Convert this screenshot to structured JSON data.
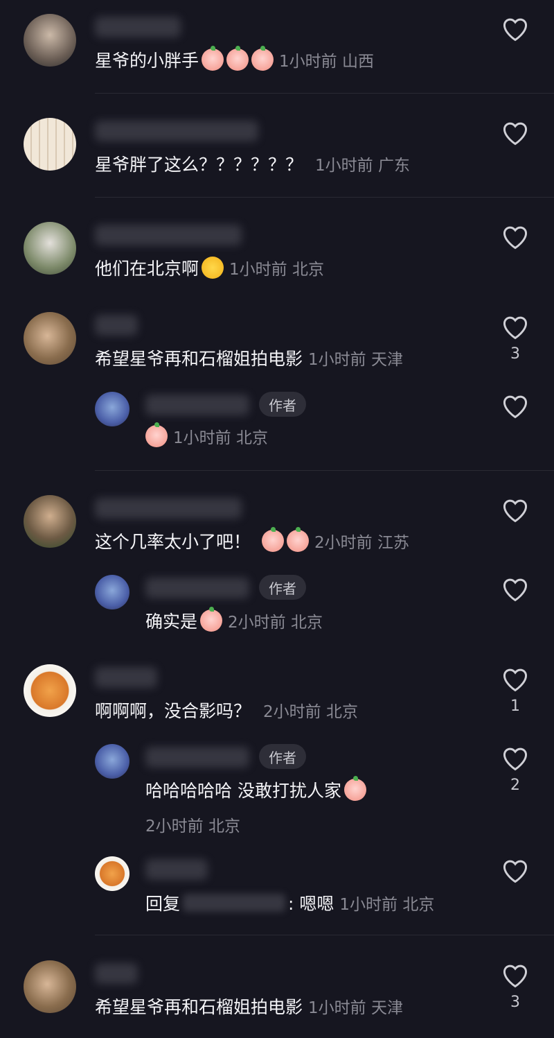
{
  "comments": [
    {
      "text": "星爷的小胖手",
      "emojis": [
        "pig-face",
        "pig-face",
        "pig-face"
      ],
      "time": "1小时前",
      "location": "山西",
      "likes": ""
    },
    {
      "text": "星爷胖了这么？？？？？？",
      "time": "1小时前",
      "location": "广东",
      "likes": ""
    },
    {
      "text": "他们在北京啊",
      "emojis": [
        "star-struck"
      ],
      "time": "1小时前",
      "location": "北京",
      "likes": ""
    },
    {
      "text": "希望星爷再和石榴姐拍电影",
      "time": "1小时前",
      "location": "天津",
      "likes": "3"
    },
    {
      "reply": true,
      "badge": "作者",
      "text": "",
      "emojis": [
        "pig-face"
      ],
      "time": "1小时前",
      "location": "北京",
      "likes": ""
    },
    {
      "text": "这个几率太小了吧！",
      "emojis": [
        "scream",
        "scream"
      ],
      "time": "2小时前",
      "location": "江苏",
      "likes": ""
    },
    {
      "reply": true,
      "badge": "作者",
      "text": "确实是",
      "emojis": [
        "pig-face"
      ],
      "time": "2小时前",
      "location": "北京",
      "likes": ""
    },
    {
      "text": "啊啊啊，没合影吗？",
      "time": "2小时前",
      "location": "北京",
      "likes": "1"
    },
    {
      "reply": true,
      "badge": "作者",
      "text": "哈哈哈哈哈 没敢打扰人家",
      "emojis": [
        "pig-face"
      ],
      "time": "2小时前",
      "location": "北京",
      "likes": "2"
    },
    {
      "reply": true,
      "reply_prefix": "回复",
      "reply_suffix": ": 嗯嗯",
      "time": "1小时前",
      "location": "北京",
      "likes": ""
    },
    {
      "text": "希望星爷再和石榴姐拍电影",
      "time": "1小时前",
      "location": "天津",
      "likes": "3"
    }
  ],
  "colors": {
    "background": "#161620",
    "meta": "#8a8a94",
    "badge_bg": "#2e2e38"
  }
}
